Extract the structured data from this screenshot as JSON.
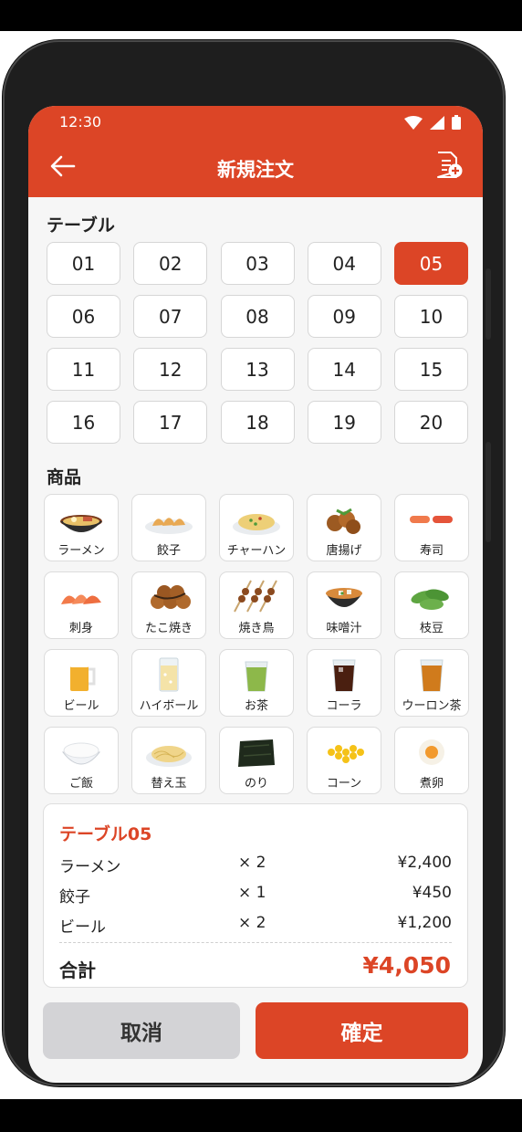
{
  "status_bar": {
    "time": "12:30"
  },
  "header": {
    "title": "新規注文"
  },
  "table_section": {
    "label": "テーブル",
    "tables": [
      "01",
      "02",
      "03",
      "04",
      "05",
      "06",
      "07",
      "08",
      "09",
      "10",
      "11",
      "12",
      "13",
      "14",
      "15",
      "16",
      "17",
      "18",
      "19",
      "20"
    ],
    "selected": "05"
  },
  "items_section": {
    "label": "商品",
    "items": [
      {
        "label": "ラーメン",
        "icon": "ramen-icon"
      },
      {
        "label": "餃子",
        "icon": "gyoza-icon"
      },
      {
        "label": "チャーハン",
        "icon": "fried-rice-icon"
      },
      {
        "label": "唐揚げ",
        "icon": "karaage-icon"
      },
      {
        "label": "寿司",
        "icon": "sushi-icon"
      },
      {
        "label": "刺身",
        "icon": "sashimi-icon"
      },
      {
        "label": "たこ焼き",
        "icon": "takoyaki-icon"
      },
      {
        "label": "焼き鳥",
        "icon": "yakitori-icon"
      },
      {
        "label": "味噌汁",
        "icon": "miso-soup-icon"
      },
      {
        "label": "枝豆",
        "icon": "edamame-icon"
      },
      {
        "label": "ビール",
        "icon": "beer-icon"
      },
      {
        "label": "ハイボール",
        "icon": "highball-icon"
      },
      {
        "label": "お茶",
        "icon": "green-tea-icon"
      },
      {
        "label": "コーラ",
        "icon": "cola-icon"
      },
      {
        "label": "ウーロン茶",
        "icon": "oolong-tea-icon"
      },
      {
        "label": "ご飯",
        "icon": "rice-bowl-icon"
      },
      {
        "label": "替え玉",
        "icon": "extra-noodles-icon"
      },
      {
        "label": "のり",
        "icon": "nori-icon"
      },
      {
        "label": "コーン",
        "icon": "corn-icon"
      },
      {
        "label": "煮卵",
        "icon": "boiled-egg-icon"
      }
    ]
  },
  "order_summary": {
    "title": "テーブル05",
    "lines": [
      {
        "name": "ラーメン",
        "qty": "× 2",
        "price": "¥2,400"
      },
      {
        "name": "餃子",
        "qty": "× 1",
        "price": "¥450"
      },
      {
        "name": "ビール",
        "qty": "× 2",
        "price": "¥1,200"
      }
    ],
    "total_label": "合計",
    "total_value": "¥4,050"
  },
  "actions": {
    "cancel_label": "取消",
    "confirm_label": "確定"
  },
  "colors": {
    "accent": "#dc4526",
    "selected_table": "#dc4526",
    "cancel_bg": "#d3d3d6",
    "screen_bg": "#f6f6f6"
  }
}
